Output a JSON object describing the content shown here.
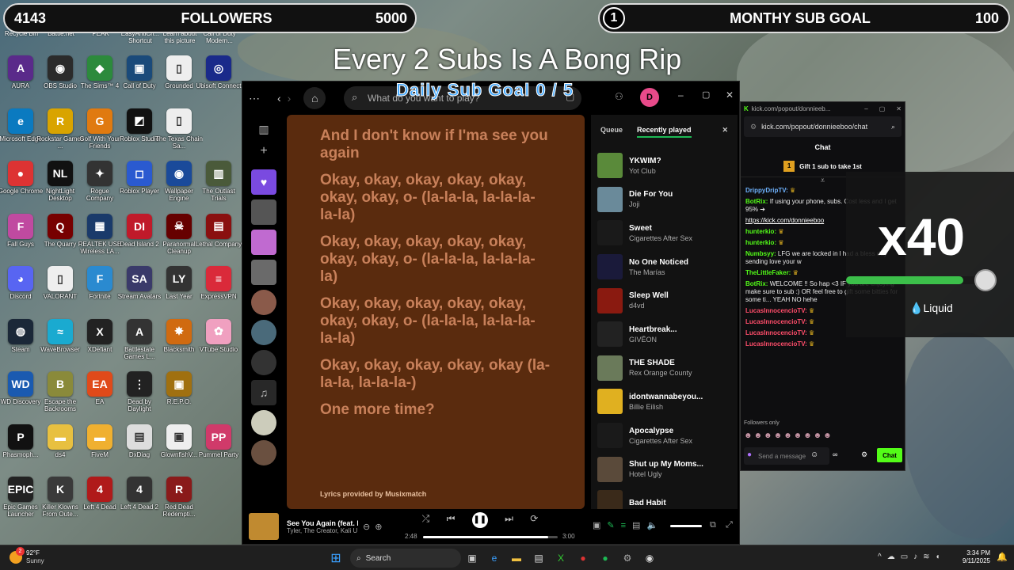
{
  "overlay": {
    "followers": {
      "count": "4143",
      "label": "FOLLOWERS",
      "goal": "5000"
    },
    "subs": {
      "count": "1",
      "label": "MONTHY SUB GOAL",
      "goal": "100"
    },
    "title": "Every 2 Subs Is A Bong Rip",
    "daily": "Daily Sub Goal  0 / 5"
  },
  "desktop": {
    "top_labels": [
      "Recycle Bin",
      "Battle.net",
      "PEAK",
      "EasyAntiCh... Shortcut",
      "Learn about this picture",
      "Call of Duty Modern..."
    ],
    "icons": [
      {
        "label": "AURA",
        "glyph": "A",
        "color": "#5a2a8a"
      },
      {
        "label": "OBS Studio",
        "glyph": "◉",
        "color": "#2b2b2b"
      },
      {
        "label": "The Sims™ 4",
        "glyph": "◆",
        "color": "#2c8a3c"
      },
      {
        "label": "Call of Duty",
        "glyph": "▣",
        "color": "#1a4a7a"
      },
      {
        "label": "Grounded",
        "glyph": "▯",
        "color": "#eee"
      },
      {
        "label": "Ubisoft Connect",
        "glyph": "◎",
        "color": "#1a2a8a"
      },
      {
        "label": "Microsoft Edge",
        "glyph": "e",
        "color": "#0a7ac0"
      },
      {
        "label": "Rockstar Games ...",
        "glyph": "R",
        "color": "#d9a400"
      },
      {
        "label": "Golf With Your Friends",
        "glyph": "G",
        "color": "#e07a10"
      },
      {
        "label": "Roblox Studio",
        "glyph": "◩",
        "color": "#111"
      },
      {
        "label": "The Texas Chain Sa...",
        "glyph": "▯",
        "color": "#eee"
      },
      {
        "label": "",
        "glyph": "",
        "color": "transparent"
      },
      {
        "label": "Google Chrome",
        "glyph": "●",
        "color": "#d33"
      },
      {
        "label": "NightLight Desktop",
        "glyph": "NL",
        "color": "#111"
      },
      {
        "label": "Rogue Company",
        "glyph": "✦",
        "color": "#333"
      },
      {
        "label": "Roblox Player",
        "glyph": "◻",
        "color": "#2a5ad0"
      },
      {
        "label": "Wallpaper Engine",
        "glyph": "◉",
        "color": "#1a4a9a"
      },
      {
        "label": "The Outlast Trials",
        "glyph": "▥",
        "color": "#4a5a3a"
      },
      {
        "label": "Fall Guys",
        "glyph": "F",
        "color": "#c04aa0"
      },
      {
        "label": "The Quarry",
        "glyph": "Q",
        "color": "#700"
      },
      {
        "label": "REALTEK USB Wireless LA...",
        "glyph": "▦",
        "color": "#1a3a6a"
      },
      {
        "label": "Dead Island 2",
        "glyph": "DI",
        "color": "#c01a2a"
      },
      {
        "label": "Paranormal Cleanup",
        "glyph": "☠",
        "color": "#600"
      },
      {
        "label": "Lethal Company",
        "glyph": "▤",
        "color": "#8a1010"
      },
      {
        "label": "Discord",
        "glyph": "◕",
        "color": "#5865f2"
      },
      {
        "label": "VALORANT",
        "glyph": "▯",
        "color": "#eee"
      },
      {
        "label": "Fortnite",
        "glyph": "F",
        "color": "#2a8ad0"
      },
      {
        "label": "Stream Avatars",
        "glyph": "SA",
        "color": "#3a3a6a"
      },
      {
        "label": "Last Year",
        "glyph": "LY",
        "color": "#333"
      },
      {
        "label": "ExpressVPN",
        "glyph": "≡",
        "color": "#da2a3a"
      },
      {
        "label": "Steam",
        "glyph": "◍",
        "color": "#1b2838"
      },
      {
        "label": "WaveBrowser",
        "glyph": "≈",
        "color": "#1aaad0"
      },
      {
        "label": "XDefiant",
        "glyph": "X",
        "color": "#222"
      },
      {
        "label": "Battlestate Games L...",
        "glyph": "A",
        "color": "#333"
      },
      {
        "label": "Blacksmith",
        "glyph": "✸",
        "color": "#d06a10"
      },
      {
        "label": "VTube Studio",
        "glyph": "✿",
        "color": "#f0a0c0"
      },
      {
        "label": "WD Discovery",
        "glyph": "WD",
        "color": "#1a5ab0"
      },
      {
        "label": "Escape the Backrooms",
        "glyph": "B",
        "color": "#8a8a3a"
      },
      {
        "label": "EA",
        "glyph": "EA",
        "color": "#e04a1a"
      },
      {
        "label": "Dead by Daylight",
        "glyph": "⋮",
        "color": "#222"
      },
      {
        "label": "R.E.P.O.",
        "glyph": "▣",
        "color": "#a07010"
      },
      {
        "label": "",
        "glyph": "",
        "color": "transparent"
      },
      {
        "label": "Phasmoph...",
        "glyph": "P",
        "color": "#111"
      },
      {
        "label": "ds4",
        "glyph": "▬",
        "color": "#e8c040"
      },
      {
        "label": "FiveM",
        "glyph": "▬",
        "color": "#f0b030"
      },
      {
        "label": "DxDiag",
        "glyph": "▤",
        "color": "#ddd"
      },
      {
        "label": "GlownfishV...",
        "glyph": "▣",
        "color": "#eee"
      },
      {
        "label": "Pummel Party",
        "glyph": "PP",
        "color": "#d03a6a"
      },
      {
        "label": "Epic Games Launcher",
        "glyph": "EPIC",
        "color": "#222"
      },
      {
        "label": "Killer Klowns From Oute...",
        "glyph": "K",
        "color": "#3a3a3a"
      },
      {
        "label": "Left 4 Dead",
        "glyph": "4",
        "color": "#b01a1a"
      },
      {
        "label": "Left 4 Dead 2",
        "glyph": "4",
        "color": "#333"
      },
      {
        "label": "Red Dead Redempti...",
        "glyph": "R",
        "color": "#8a1a1a"
      },
      {
        "label": "",
        "glyph": "",
        "color": "transparent"
      }
    ]
  },
  "spotify": {
    "search_placeholder": "What do you want to play?",
    "avatar": "D",
    "lyrics": [
      "And I don't know if I'ma see you again",
      "Okay, okay, okay, okay, okay, okay, okay, o- (la-la-la, la-la-la-la-la)",
      "Okay, okay, okay, okay, okay, okay, okay, o- (la-la-la, la-la-la-la)",
      "Okay, okay, okay, okay, okay, okay, okay, o- (la-la-la, la-la-la-la-la)",
      "Okay, okay, okay, okay, okay (la-la-la, la-la-la-)",
      "One more time?"
    ],
    "lyrics_footer": "Lyrics provided by Musixmatch",
    "queue_tab": "Queue",
    "recent_tab": "Recently played",
    "recent": [
      {
        "title": "YKWIM?",
        "artist": "Yot Club",
        "color": "#5a8a3a"
      },
      {
        "title": "Die For You",
        "artist": "Joji",
        "color": "#6a8a9a"
      },
      {
        "title": "Sweet",
        "artist": "Cigarettes After Sex",
        "color": "#1a1a1a"
      },
      {
        "title": "No One Noticed",
        "artist": "The Marías",
        "color": "#1a1a3a"
      },
      {
        "title": "Sleep Well",
        "artist": "d4vd",
        "color": "#8a1a10"
      },
      {
        "title": "Heartbreak...",
        "artist": "GIVĒON",
        "color": "#222"
      },
      {
        "title": "THE SHADE",
        "artist": "Rex Orange County",
        "color": "#6a7a5a"
      },
      {
        "title": "idontwannabeyou...",
        "artist": "Billie Eilish",
        "color": "#e0b020"
      },
      {
        "title": "Apocalypse",
        "artist": "Cigarettes After Sex",
        "color": "#1a1a1a"
      },
      {
        "title": "Shut up My Moms...",
        "artist": "Hotel Ugly",
        "color": "#5a4a3a"
      },
      {
        "title": "Bad Habit",
        "artist": "",
        "color": "#3a2a1a"
      }
    ],
    "now_playing": {
      "title": "See You Again (feat. K",
      "artist": "Tyler, The Creator, Kali U",
      "elapsed": "2:48",
      "duration": "3:00",
      "progress": 0.93
    }
  },
  "kick": {
    "window_title": "kick.com/popout/donnieeb...",
    "url": "kick.com/popout/donnieeboo/chat",
    "header": "Chat",
    "gift": "Gift 1 sub to take 1st",
    "messages": [
      {
        "user": "DrippyDripTV:",
        "text": "",
        "cls": "u-blue"
      },
      {
        "user": "BotRix:",
        "text": "If using your phone, subs. Cost less and I get 95% ➔",
        "cls": "u-green"
      },
      {
        "user": "",
        "text": "https://kick.com/donnieeboo",
        "cls": ""
      },
      {
        "user": "hunterkio:",
        "text": "",
        "cls": "u-green"
      },
      {
        "user": "hunterkio:",
        "text": "",
        "cls": "u-green"
      },
      {
        "user": "Numbsyy:",
        "text": "LFG we are locked in l had a bless day sending love your w",
        "cls": "u-green"
      },
      {
        "user": "TheLittleFaker:",
        "text": "",
        "cls": "u-green"
      },
      {
        "user": "BotRix:",
        "text": "WELCOME !! So hap <3 IF you are enjoying make sure to sub :) OR feel free to gift some bitties for some ti... YEAH NO hehe",
        "cls": "u-green"
      },
      {
        "user": "LucasInnocencioTV:",
        "text": "",
        "cls": "u-red"
      },
      {
        "user": "LucasInnocencioTV:",
        "text": "",
        "cls": "u-red"
      },
      {
        "user": "LucasInnocencioTV:",
        "text": "",
        "cls": "u-red"
      },
      {
        "user": "LucasInnocencioTV:",
        "text": "",
        "cls": "u-red"
      }
    ],
    "followers_only": "Followers only",
    "send_placeholder": "Send a message",
    "chat_button": "Chat"
  },
  "liquid": {
    "multiplier": "x40",
    "brand": "Liquid",
    "level": 0.82
  },
  "taskbar": {
    "weather": "92°F",
    "weather_desc": "Sunny",
    "search": "Search",
    "time": "3:34 PM",
    "date": "9/11/2025",
    "badge": "2"
  }
}
